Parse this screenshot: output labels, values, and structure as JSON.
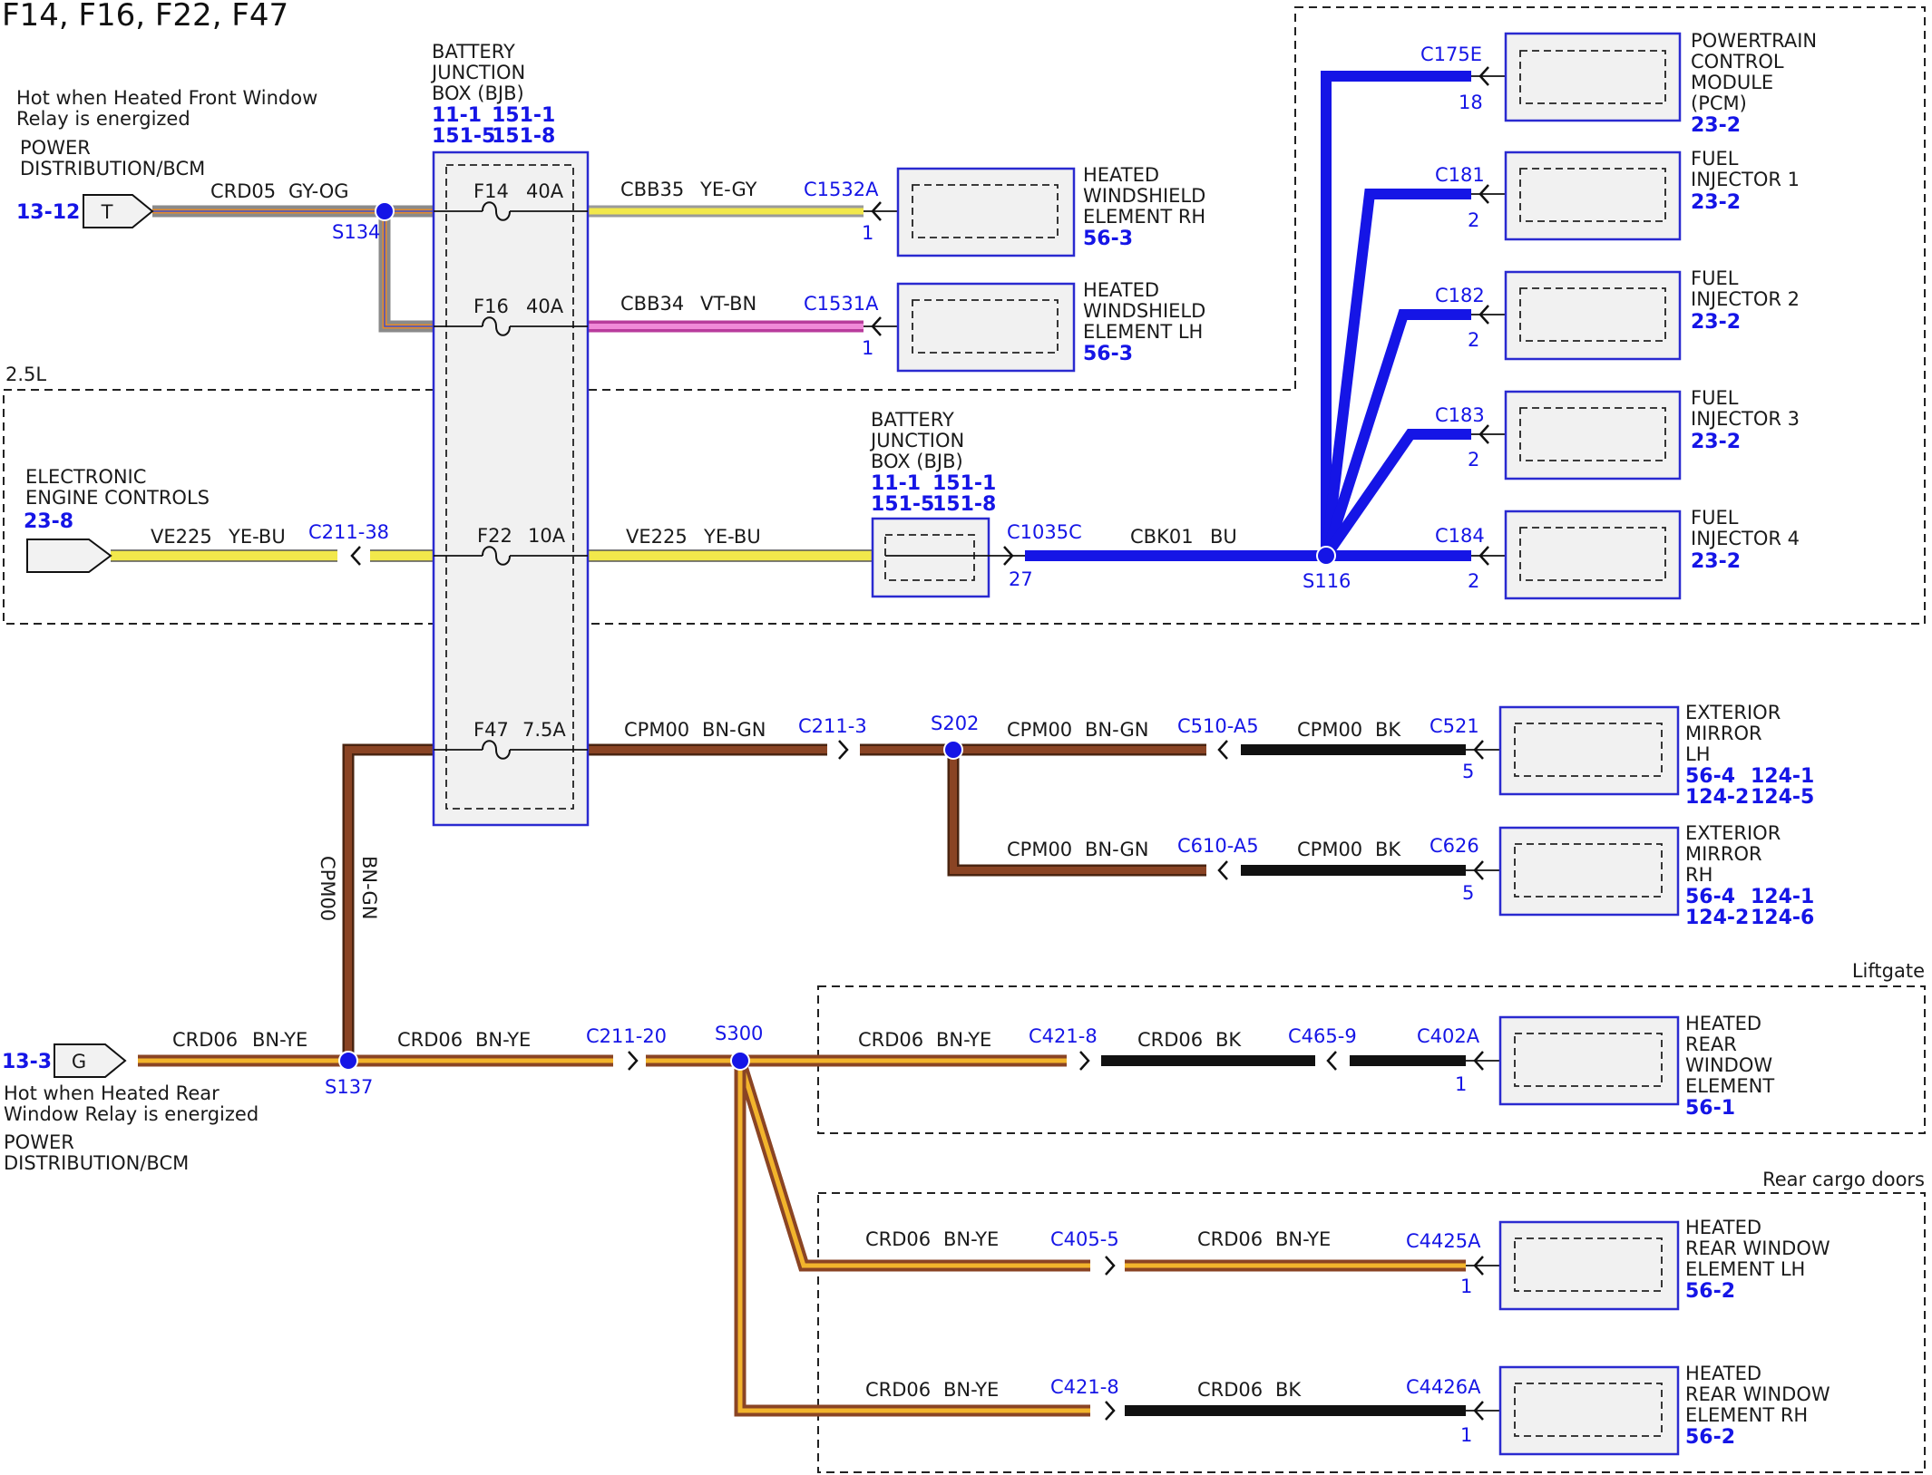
{
  "title": "F14, F16, F22, F47",
  "groups": {
    "engine": "2.5L",
    "liftgate": "Liftgate",
    "rear_doors": "Rear cargo doors"
  },
  "bjb": {
    "label1": "BATTERY",
    "label2": "JUNCTION",
    "label3": "BOX (BJB)",
    "ref1": "11-1",
    "ref2": "151-1",
    "ref3": "151-5",
    "ref4": "151-8"
  },
  "bjb2": {
    "label1": "BATTERY",
    "label2": "JUNCTION",
    "label3": "BOX (BJB)",
    "ref1": "11-1",
    "ref2": "151-1",
    "ref3": "151-5",
    "ref4": "151-8"
  },
  "fuses": [
    {
      "name": "F14",
      "rating": "40A"
    },
    {
      "name": "F16",
      "rating": "40A"
    },
    {
      "name": "F22",
      "rating": "10A"
    },
    {
      "name": "F47",
      "rating": "7.5A"
    }
  ],
  "top_source": {
    "note1": "Hot when Heated Front Window",
    "note2": "Relay is energized",
    "name1": "POWER",
    "name2": "DISTRIBUTION/BCM",
    "ref": "13-12",
    "pin": "T",
    "wire": "CRD05",
    "color": "GY-OG",
    "splice": "S134"
  },
  "eec": {
    "name1": "ELECTRONIC",
    "name2": "ENGINE CONTROLS",
    "ref": "23-8",
    "wire": "VE225",
    "color": "YE-BU",
    "connector": "C211-38"
  },
  "bottom_source": {
    "note1": "Hot when Heated Rear",
    "note2": "Window Relay is energized",
    "name1": "POWER",
    "name2": "DISTRIBUTION/BCM",
    "ref": "13-3",
    "pin": "G",
    "wire": "CRD06",
    "color": "BN-YE",
    "splice": "S137"
  },
  "windshield": [
    {
      "wire": "CBB35",
      "color": "YE-GY",
      "connector": "C1532A",
      "pin": "1",
      "name1": "HEATED",
      "name2": "WINDSHIELD",
      "name3": "ELEMENT RH",
      "ref": "56-3"
    },
    {
      "wire": "CBB34",
      "color": "VT-BN",
      "connector": "C1531A",
      "pin": "1",
      "name1": "HEATED",
      "name2": "WINDSHIELD",
      "name3": "ELEMENT LH",
      "ref": "56-3"
    }
  ],
  "f22_out": {
    "wire": "VE225",
    "color": "YE-BU",
    "connector": "C1035C",
    "pin": "27",
    "wire2": "CBK01",
    "color2": "BU",
    "splice": "S116"
  },
  "pcm": {
    "connector": "C175E",
    "pin": "18",
    "name1": "POWERTRAIN",
    "name2": "CONTROL",
    "name3": "MODULE",
    "name4": "(PCM)",
    "ref": "23-2"
  },
  "injectors": [
    {
      "connector": "C181",
      "pin": "2",
      "name1": "FUEL",
      "name2": "INJECTOR 1",
      "ref": "23-2"
    },
    {
      "connector": "C182",
      "pin": "2",
      "name1": "FUEL",
      "name2": "INJECTOR 2",
      "ref": "23-2"
    },
    {
      "connector": "C183",
      "pin": "2",
      "name1": "FUEL",
      "name2": "INJECTOR 3",
      "ref": "23-2"
    },
    {
      "connector": "C184",
      "pin": "2",
      "name1": "FUEL",
      "name2": "INJECTOR 4",
      "ref": "23-2"
    }
  ],
  "cpm_vertical": {
    "wire": "CPM00",
    "color": "BN-GN"
  },
  "mirrors": {
    "wire": "CPM00",
    "color": "BN-GN",
    "connector": "C211-3",
    "splice": "S202",
    "lh": {
      "wire": "CPM00",
      "color": "BN-GN",
      "inline": "C510-A5",
      "wire2": "CPM00",
      "color2": "BK",
      "connector": "C521",
      "pin": "5",
      "name1": "EXTERIOR",
      "name2": "MIRROR",
      "name3": "LH",
      "ref1": "56-4",
      "ref2": "124-1",
      "ref3": "124-2",
      "ref4": "124-5"
    },
    "rh": {
      "wire": "CPM00",
      "color": "BN-GN",
      "inline": "C610-A5",
      "wire2": "CPM00",
      "color2": "BK",
      "connector": "C626",
      "pin": "5",
      "name1": "EXTERIOR",
      "name2": "MIRROR",
      "name3": "RH",
      "ref1": "56-4",
      "ref2": "124-1",
      "ref3": "124-2",
      "ref4": "124-6"
    }
  },
  "rear": {
    "wire": "CRD06",
    "color": "BN-YE",
    "connector": "C211-20",
    "splice": "S300",
    "liftgate": {
      "wire": "CRD06",
      "color": "BN-YE",
      "inline1": "C421-8",
      "wire2": "CRD06",
      "color2": "BK",
      "inline2": "C465-9",
      "connector": "C402A",
      "pin": "1",
      "name1": "HEATED",
      "name2": "REAR",
      "name3": "WINDOW",
      "name4": "ELEMENT",
      "ref": "56-1"
    },
    "lh": {
      "wire": "CRD06",
      "color": "BN-YE",
      "inline": "C405-5",
      "wire2": "CRD06",
      "color2": "BN-YE",
      "connector": "C4425A",
      "pin": "1",
      "name1": "HEATED",
      "name2": "REAR WINDOW",
      "name3": "ELEMENT LH",
      "ref": "56-2"
    },
    "rh": {
      "wire": "CRD06",
      "color": "BN-YE",
      "inline": "C421-8",
      "wire2": "CRD06",
      "color2": "BK",
      "connector": "C4426A",
      "pin": "1",
      "name1": "HEATED",
      "name2": "REAR WINDOW",
      "name3": "ELEMENT RH",
      "ref": "56-2"
    }
  },
  "colors": {
    "blue": "#1515e6",
    "brown": "#7a3a1c",
    "yellow": "#f2e84b",
    "black": "#111111",
    "pink": "#e06ac8",
    "gray": "#8a8a8a",
    "orange": "#e38a2c"
  }
}
